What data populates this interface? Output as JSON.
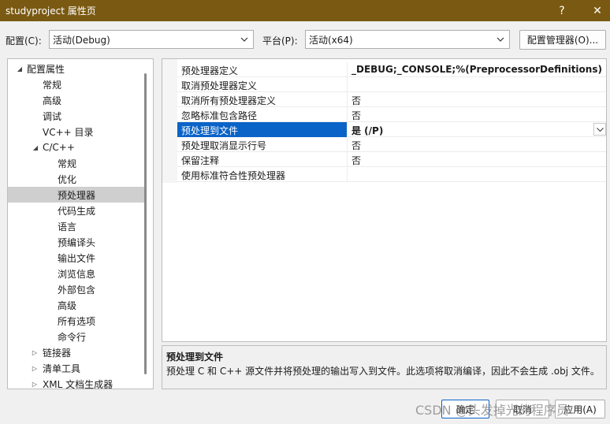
{
  "window": {
    "title": "studyproject 属性页",
    "help_label": "?",
    "close_label": "✕"
  },
  "topbar": {
    "config_label": "配置(C):",
    "config_value": "活动(Debug)",
    "platform_label": "平台(P):",
    "platform_value": "活动(x64)",
    "config_manager_label": "配置管理器(O)..."
  },
  "tree": {
    "items": [
      {
        "label": "配置属性",
        "arrow": "◢"
      },
      {
        "label": "常规"
      },
      {
        "label": "高级"
      },
      {
        "label": "调试"
      },
      {
        "label": "VC++ 目录"
      },
      {
        "label": "C/C++",
        "arrow": "◢"
      },
      {
        "label": "常规"
      },
      {
        "label": "优化"
      },
      {
        "label": "预处理器",
        "selected": true
      },
      {
        "label": "代码生成"
      },
      {
        "label": "语言"
      },
      {
        "label": "预编译头"
      },
      {
        "label": "输出文件"
      },
      {
        "label": "浏览信息"
      },
      {
        "label": "外部包含"
      },
      {
        "label": "高级"
      },
      {
        "label": "所有选项"
      },
      {
        "label": "命令行"
      },
      {
        "label": "链接器",
        "arrow": "▷"
      },
      {
        "label": "清单工具",
        "arrow": "▷"
      },
      {
        "label": "XML 文档生成器",
        "arrow": "▷"
      }
    ]
  },
  "properties": {
    "rows": [
      {
        "name": "预处理器定义",
        "value": "_DEBUG;_CONSOLE;%(PreprocessorDefinitions)",
        "bold": true
      },
      {
        "name": "取消预处理器定义",
        "value": ""
      },
      {
        "name": "取消所有预处理器定义",
        "value": "否"
      },
      {
        "name": "忽略标准包含路径",
        "value": "否"
      },
      {
        "name": "预处理到文件",
        "value": "是 (/P)",
        "bold": true,
        "selected": true
      },
      {
        "name": "预处理取消显示行号",
        "value": "否"
      },
      {
        "name": "保留注释",
        "value": "否"
      },
      {
        "name": "使用标准符合性预处理器",
        "value": ""
      }
    ]
  },
  "description": {
    "title": "预处理到文件",
    "text": "预处理 C 和 C++ 源文件并将预处理的输出写入到文件。此选项将取消编译，因此不会生成 .obj 文件。"
  },
  "buttons": {
    "ok": "确定",
    "cancel": "取消",
    "apply": "应用(A)"
  },
  "watermark": "CSDN @头发掉光的程序员"
}
